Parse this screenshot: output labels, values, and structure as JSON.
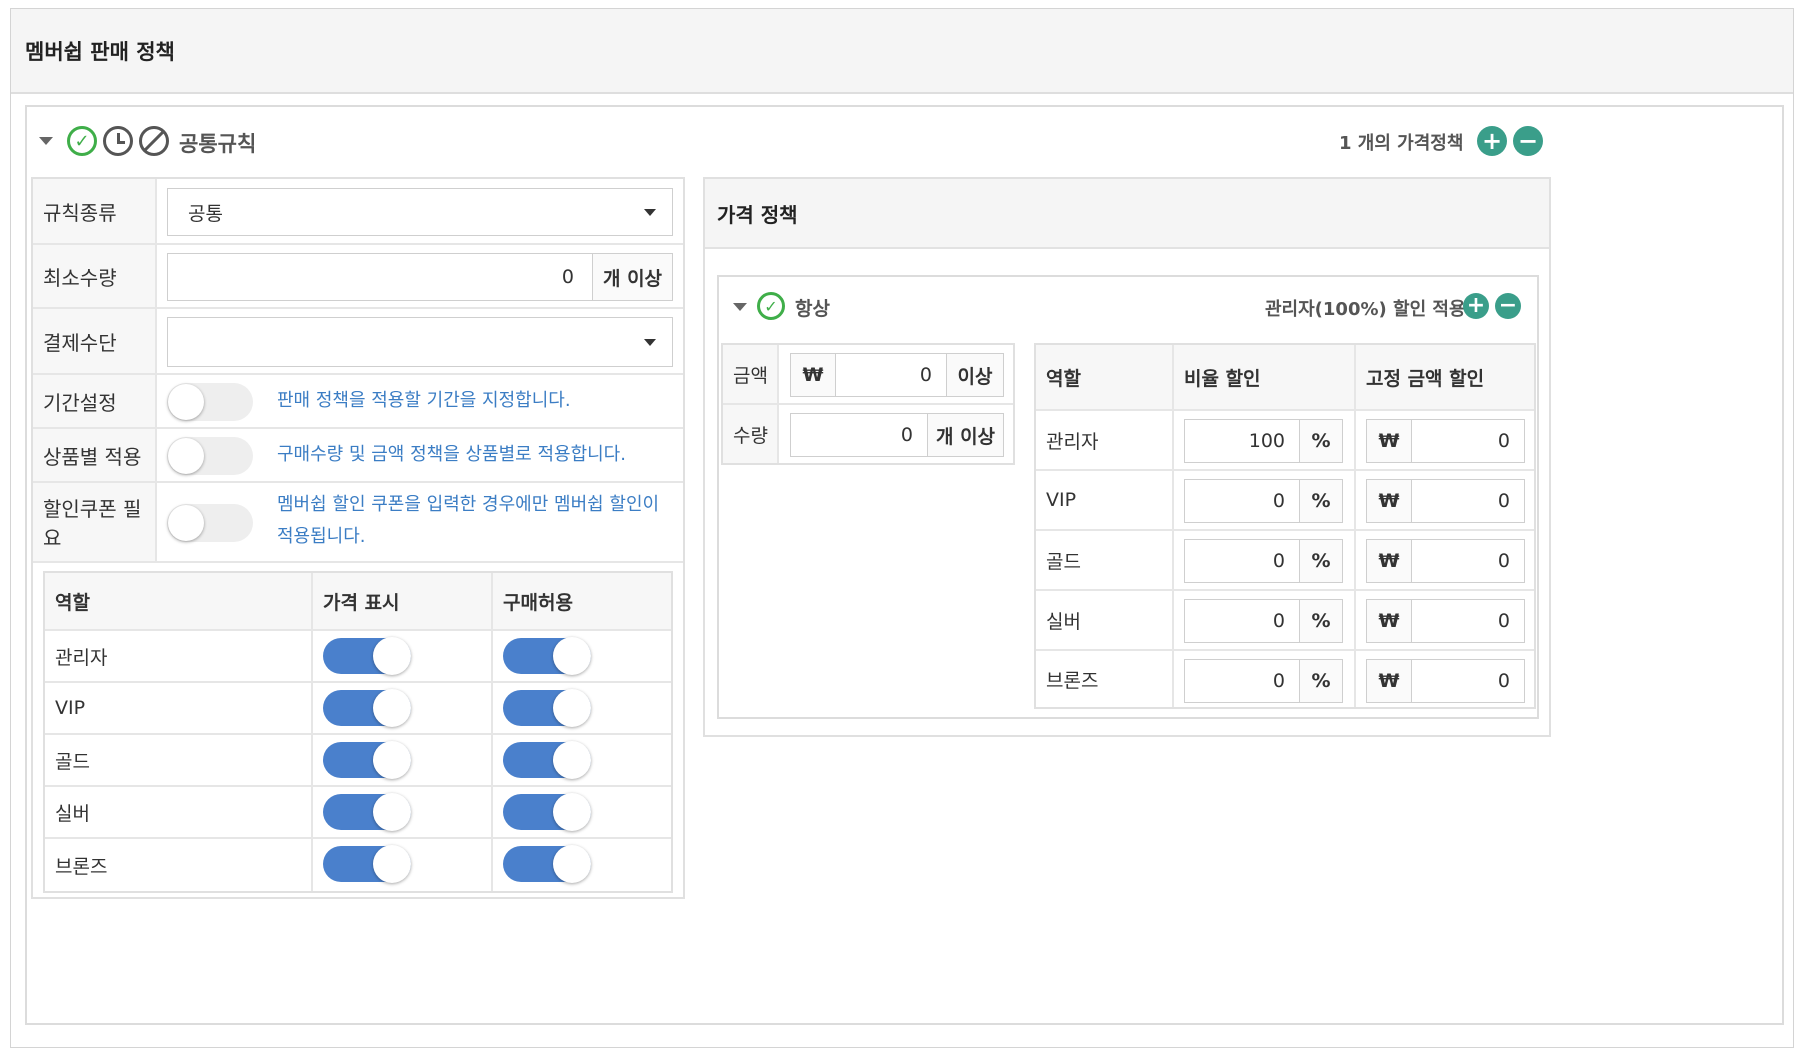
{
  "page": {
    "title": "멤버쉽 판매 정책"
  },
  "rule": {
    "title": "공통규칙",
    "policy_count": "1 개의 가격정책",
    "fields": {
      "rule_type_label": "규칙종류",
      "rule_type_value": "공통",
      "min_qty_label": "최소수량",
      "min_qty_value": "0",
      "min_qty_unit": "개 이상",
      "payment_label": "결제수단",
      "payment_value": "",
      "period_label": "기간설정",
      "period_desc": "판매 정책을 적용할 기간을 지정합니다.",
      "per_product_label": "상품별 적용",
      "per_product_desc": "구매수량 및 금액 정책을 상품별로 적용합니다.",
      "coupon_label": "할인쿠폰 필요",
      "coupon_desc": "멤버쉽 할인 쿠폰을 입력한 경우에만 멤버쉽 할인이 적용됩니다."
    },
    "role_table": {
      "headers": [
        "역할",
        "가격 표시",
        "구매허용"
      ],
      "rows": [
        {
          "role": "관리자",
          "show_price": true,
          "allow_purchase": true
        },
        {
          "role": "VIP",
          "show_price": true,
          "allow_purchase": true
        },
        {
          "role": "골드",
          "show_price": true,
          "allow_purchase": true
        },
        {
          "role": "실버",
          "show_price": true,
          "allow_purchase": true
        },
        {
          "role": "브론즈",
          "show_price": true,
          "allow_purchase": true
        }
      ]
    }
  },
  "price_policy": {
    "title": "가격 정책",
    "item": {
      "title": "항상",
      "summary": "관리자(100%) 할인 적용",
      "amount_label": "금액",
      "amount_currency": "₩",
      "amount_value": "0",
      "amount_unit": "이상",
      "qty_label": "수량",
      "qty_value": "0",
      "qty_unit": "개 이상",
      "discount_table": {
        "headers": [
          "역할",
          "비율 할인",
          "고정 금액 할인"
        ],
        "percent_symbol": "%",
        "currency_symbol": "₩",
        "rows": [
          {
            "role": "관리자",
            "rate": "100",
            "fixed": "0"
          },
          {
            "role": "VIP",
            "rate": "0",
            "fixed": "0"
          },
          {
            "role": "골드",
            "rate": "0",
            "fixed": "0"
          },
          {
            "role": "실버",
            "rate": "0",
            "fixed": "0"
          },
          {
            "role": "브론즈",
            "rate": "0",
            "fixed": "0"
          }
        ]
      }
    }
  },
  "colors": {
    "accent": "#3a9e8a",
    "check": "#3fae49",
    "toggle_on": "#4a80cc",
    "link_text": "#3b7dc4"
  },
  "icons": [
    "caret-down-icon",
    "check-circle-icon",
    "clock-icon",
    "ban-icon",
    "plus-circle-icon",
    "minus-circle-icon"
  ]
}
